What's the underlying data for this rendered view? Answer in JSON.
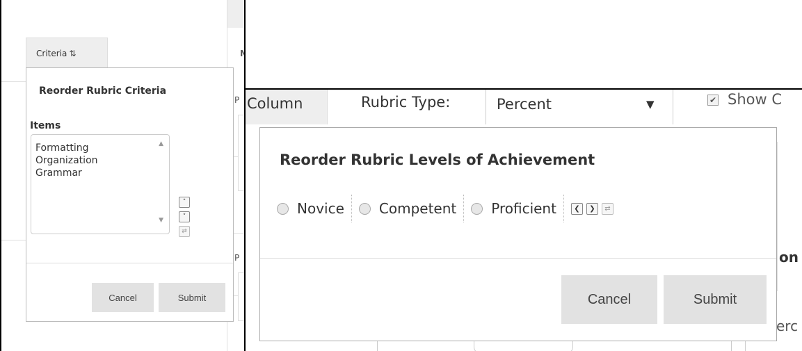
{
  "left": {
    "tab": {
      "label": "Criteria",
      "sort_icon": "sort-arrows-icon"
    },
    "background_letters": [
      "N",
      "P",
      "P"
    ],
    "panel": {
      "title": "Reorder Rubric Criteria",
      "items_label": "Items",
      "items": [
        "Formatting",
        "Organization",
        "Grammar"
      ],
      "cancel_label": "Cancel",
      "submit_label": "Submit"
    }
  },
  "right": {
    "toolbar": {
      "column_tab": "Column",
      "rubric_type_label": "Rubric Type:",
      "rubric_type_value": "Percent",
      "show_label": "Show C"
    },
    "background_text": {
      "on": "on",
      "erc": "erc"
    },
    "dialog": {
      "title": "Reorder Rubric Levels of Achievement",
      "levels": [
        "Novice",
        "Competent",
        "Proficient"
      ],
      "cancel_label": "Cancel",
      "submit_label": "Submit"
    }
  },
  "colors": {
    "button_gray": "#e2e2e2",
    "tab_gray": "#eeeeee",
    "border": "#aaaaaa",
    "text": "#333333"
  }
}
